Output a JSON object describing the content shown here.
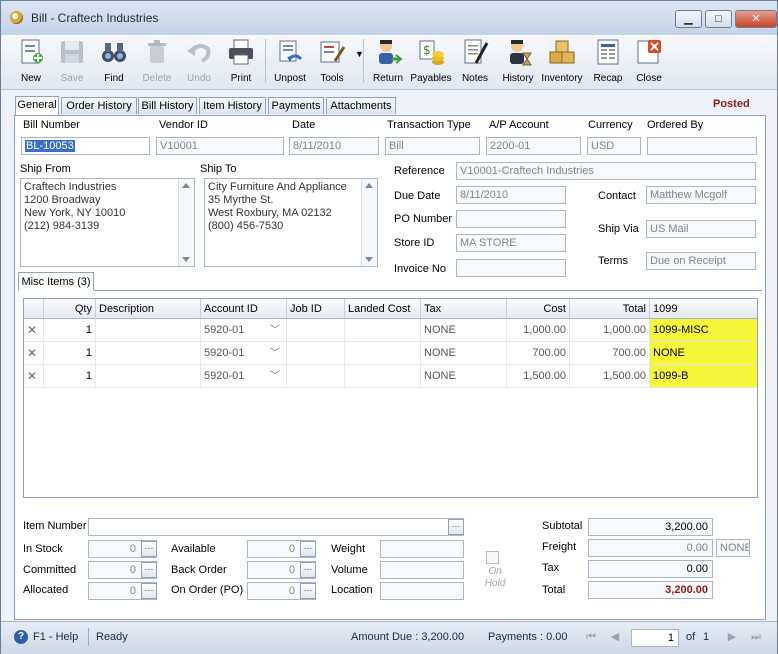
{
  "window": {
    "title": "Bill - Craftech Industries",
    "minimize": "▁",
    "maximize": "□",
    "close": "✕"
  },
  "toolbar": {
    "items": [
      {
        "label": "New",
        "icon": "new-document-icon"
      },
      {
        "label": "Save",
        "icon": "save-disk-icon"
      },
      {
        "label": "Find",
        "icon": "binoculars-icon"
      },
      {
        "label": "Delete",
        "icon": "trash-icon"
      },
      {
        "label": "Undo",
        "icon": "undo-arrow-icon"
      },
      {
        "label": "Print",
        "icon": "printer-icon"
      },
      {
        "label": "Unpost",
        "icon": "unpost-icon"
      },
      {
        "label": "Tools",
        "icon": "tools-icon"
      },
      {
        "label": "Return",
        "icon": "return-person-icon"
      },
      {
        "label": "Payables",
        "icon": "payables-icon"
      },
      {
        "label": "Notes",
        "icon": "notes-pen-icon"
      },
      {
        "label": "History",
        "icon": "history-icon"
      },
      {
        "label": "Inventory",
        "icon": "inventory-boxes-icon"
      },
      {
        "label": "Recap",
        "icon": "recap-icon"
      },
      {
        "label": "Close",
        "icon": "close-form-icon"
      }
    ]
  },
  "tabs": [
    "General",
    "Order History",
    "Bill History",
    "Item History",
    "Payments",
    "Attachments"
  ],
  "status_badge": "Posted",
  "header": {
    "bill_number_label": "Bill Number",
    "bill_number": "BL-10053",
    "vendor_id_label": "Vendor ID",
    "vendor_id": "V10001",
    "date_label": "Date",
    "date": "8/11/2010",
    "transaction_type_label": "Transaction Type",
    "transaction_type": "Bill",
    "ap_account_label": "A/P Account",
    "ap_account": "2200-01",
    "currency_label": "Currency",
    "currency": "USD",
    "ordered_by_label": "Ordered By",
    "ordered_by": ""
  },
  "ship_from": {
    "label": "Ship From",
    "text": "Craftech Industries\n1200 Broadway\nNew York, NY 10010\n(212) 984-3139"
  },
  "ship_to": {
    "label": "Ship To",
    "text": "City Furniture And Appliance\n35 Myrthe St.\nWest Roxbury, MA 02132\n(800) 456-7530"
  },
  "details": {
    "reference_label": "Reference",
    "reference": "V10001-Craftech Industries",
    "due_date_label": "Due Date",
    "due_date": "8/11/2010",
    "po_number_label": "PO Number",
    "po_number": "",
    "store_id_label": "Store ID",
    "store_id": "MA STORE",
    "invoice_no_label": "Invoice No",
    "invoice_no": "",
    "contact_label": "Contact",
    "contact": "Matthew Mcgolf",
    "ship_via_label": "Ship Via",
    "ship_via": "US Mail",
    "terms_label": "Terms",
    "terms": "Due on Receipt"
  },
  "misc_tab": "Misc Items (3)",
  "grid": {
    "columns": [
      "Qty",
      "Description",
      "Account ID",
      "Job ID",
      "Landed Cost",
      "Tax",
      "Cost",
      "Total",
      "1099"
    ],
    "rows": [
      {
        "qty": "1",
        "description": "",
        "account_id": "5920-01",
        "job_id": "",
        "landed_cost": "",
        "tax": "NONE",
        "cost": "1,000.00",
        "total": "1,000.00",
        "f1099": "1099-MISC"
      },
      {
        "qty": "1",
        "description": "",
        "account_id": "5920-01",
        "job_id": "",
        "landed_cost": "",
        "tax": "NONE",
        "cost": "700.00",
        "total": "700.00",
        "f1099": "NONE"
      },
      {
        "qty": "1",
        "description": "",
        "account_id": "5920-01",
        "job_id": "",
        "landed_cost": "",
        "tax": "NONE",
        "cost": "1,500.00",
        "total": "1,500.00",
        "f1099": "1099-B"
      }
    ],
    "highlight_color": "#f5f53a"
  },
  "item_panel": {
    "item_number_label": "Item Number",
    "in_stock_label": "In Stock",
    "in_stock": "0",
    "committed_label": "Committed",
    "committed": "0",
    "allocated_label": "Allocated",
    "allocated": "0",
    "available_label": "Available",
    "available": "0",
    "back_order_label": "Back Order",
    "back_order": "0",
    "on_order_label": "On Order (PO)",
    "on_order": "0",
    "weight_label": "Weight",
    "volume_label": "Volume",
    "location_label": "Location",
    "on_hold_label": "On Hold"
  },
  "totals": {
    "subtotal_label": "Subtotal",
    "subtotal": "3,200.00",
    "freight_label": "Freight",
    "freight": "0.00",
    "freight_tax": "NONE",
    "tax_label": "Tax",
    "tax": "0.00",
    "total_label": "Total",
    "total": "3,200.00"
  },
  "statusbar": {
    "help": "F1 - Help",
    "status": "Ready",
    "amount_due": "Amount Due : 3,200.00",
    "payments": "Payments : 0.00",
    "page": "1",
    "of": "of",
    "page_count": "1"
  }
}
